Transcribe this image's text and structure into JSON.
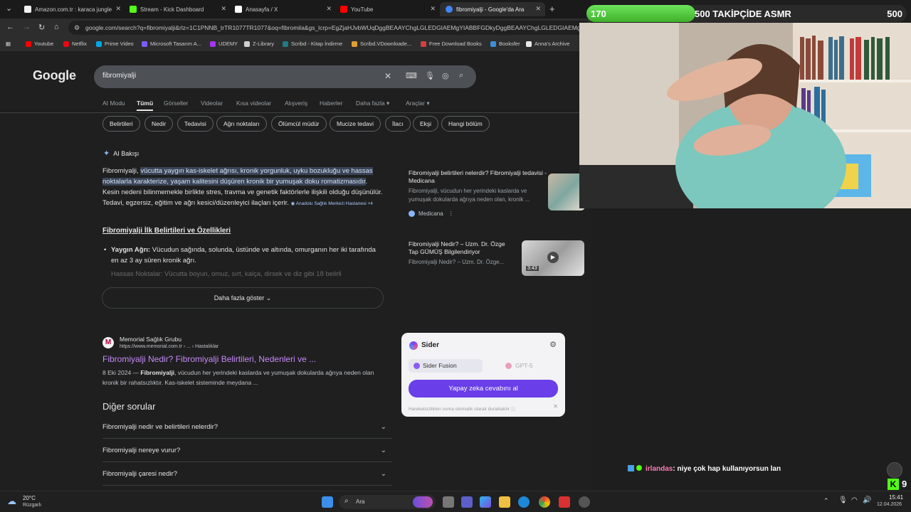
{
  "browser": {
    "tabs": [
      {
        "label": "Amazon.com.tr : karaca jungle",
        "color": "#f1f1f1"
      },
      {
        "label": "Stream - Kick Dashboard",
        "color": "#53fc18"
      },
      {
        "label": "Anasayfa / X",
        "color": "#ffffff"
      },
      {
        "label": "YouTube",
        "color": "#ff0000"
      },
      {
        "label": "fibromiyalji - Google'da Ara",
        "color": "#4285f4"
      }
    ],
    "url": "google.com/search?q=fibromiyalji&rlz=1C1PNNB_trTR1077TR1077&oq=fibromila&gs_lcrp=EgZjaHJvbWUqDggBEAAYChgLGLEDGIAEMgYIABBFGDkyDggBEAAYChgLGLEDGIAEMgs",
    "bookmarks": [
      "Youtube",
      "Netflix",
      "Prime Video",
      "Microsoft Tasarım A...",
      "UDEMY",
      "Z-Library",
      "Scribd - Kitap İndirme",
      "Scribd.VDownloade...",
      "Free Download Books",
      "Booksfer",
      "Anna's Archive"
    ]
  },
  "google": {
    "logo": "Google",
    "query": "fibromiyalji",
    "tabs": [
      "AI Modu",
      "Tümü",
      "Görseller",
      "Videolar",
      "Kısa videolar",
      "Alışveriş",
      "Haberler",
      "Daha fazla",
      "Araçlar"
    ],
    "chips": [
      "Belirtileri",
      "Nedir",
      "Tedavisi",
      "Ağrı noktaları",
      "Ölümcül müdür",
      "Mucize tedavi",
      "İlacı",
      "Ekşi",
      "Hangi bölüm"
    ],
    "ai_overview": {
      "label": "AI Bakışı",
      "text_start": "Fibromiyalji, ",
      "text_highlight": "vücutta yaygın kas-iskelet ağrısı, kronik yorgunluk, uyku bozukluğu ve hassas noktalarla karakterize, yaşam kalitesini düşüren kronik bir yumuşak doku romatizmasıdır",
      "text_rest": ". Kesin nedeni bilinmemekle birlikte stres, travma ve genetik faktörlerle ilişkili olduğu düşünülür. Tedavi, egzersiz, eğitim ve ağrı kesici/düzenleyici ilaçları içerir.",
      "source_chip": "Anadolu Sağlık Merkezi Hastanesi +4",
      "section_title": "Fibromiyalji İlk Belirtileri ve Özellikleri",
      "bullet1_bold": "Yaygın Ağrı:",
      "bullet1_text": " Vücudun sağında, solunda, üstünde ve altında, omurganın her iki tarafında en az 3 ay süren kronik ağrı.",
      "bullet2": "Hassas Noktalar: Vücutta boyun, omuz, sırt, kalça, dirsek ve diz gibi 18 belirli",
      "more_button": "Daha fazla göster"
    },
    "side_cards": [
      {
        "title": "Fibromiyalji belirtileri nelerdir? Fibromiyalji tedavisi - Medicana",
        "desc": "Fibromiyalji, vücudun her yerindeki kaslarda ve yumuşak dokularda ağrıya neden olan, kronik ...",
        "source": "Medicana"
      },
      {
        "title": "Fibromiyalji Nedir? – Uzm. Dr. Özge Tap GÜMÜŞ Bilgilendiriyor",
        "desc": "Fibromiyalji Nedir? – Uzm. Dr. Özge...",
        "duration": "3:43"
      }
    ],
    "result": {
      "site": "Memorial Sağlık Grubu",
      "crumb": "https://www.memorial.com.tr › ... › Hastalıklar",
      "title": "Fibromiyalji Nedir? Fibromiyalji Belirtileri, Nedenleri ve ...",
      "date": "8 Eki 2024 — ",
      "snippet_bold": "Fibromiyalji",
      "snippet": ", vücudun her yerindeki kaslarda ve yumuşak dokularda ağrıya neden olan kronik bir rahatsızlıktır. Kas-iskelet sisteminde meydana ..."
    },
    "paa": {
      "title": "Diğer sorular",
      "questions": [
        "Fibromiyalji nedir ve belirtileri nelerdir?",
        "Fibromiyalji nereye vurur?",
        "Fibromiyalji çaresi nedir?"
      ]
    }
  },
  "sider": {
    "name": "Sider",
    "option1": "Sider Fusion",
    "option2": "GPT-5",
    "cta": "Yapay zeka cevabını al",
    "footer": "Hareketsizlikten sonra otomatik olarak duraklatılır ⓘ"
  },
  "stream": {
    "goal_start": "170",
    "goal_label": "500 TAKİPÇİDE ASMR",
    "goal_end": "500",
    "goal_current": 170,
    "goal_target": 500,
    "chat_user": "irlandas",
    "chat_message": ": niye çok hap kullanıyorsun lan"
  },
  "taskbar": {
    "weather_temp": "20°C",
    "weather_desc": "Rüzgarlı",
    "search_label": "Ara",
    "time": "15:41",
    "date": "12.04.2026"
  }
}
